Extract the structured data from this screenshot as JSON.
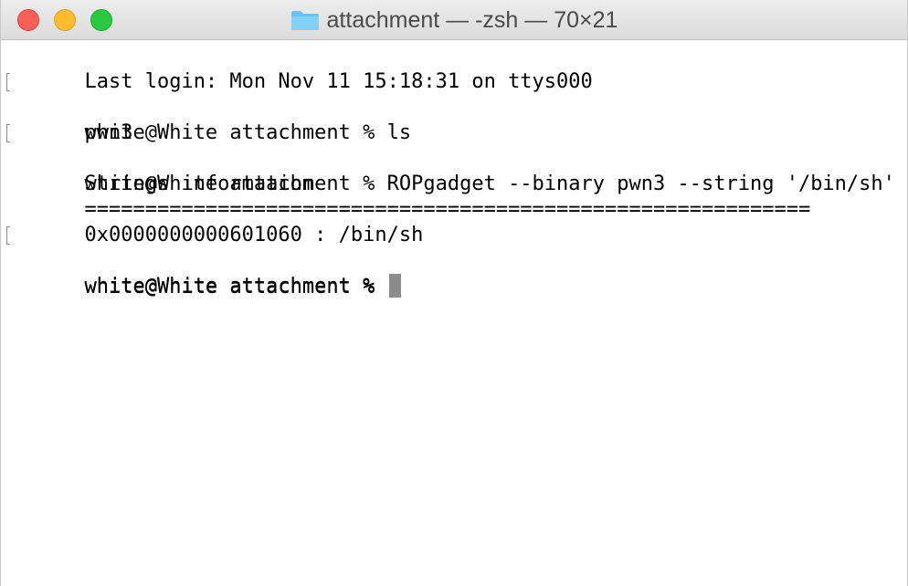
{
  "window": {
    "title": "attachment — -zsh — 70×21",
    "icon": "folder-icon",
    "buttons": {
      "close": "close-icon",
      "minimize": "minimize-icon",
      "zoom": "zoom-icon"
    }
  },
  "terminal": {
    "lines": [
      "Last login: Mon Nov 11 15:18:31 on ttys000",
      "white@White attachment % ls",
      "pwn3",
      "white@White attachment % ROPgadget --binary pwn3 --string '/bin/sh'",
      "Strings information",
      "============================================================",
      "0x0000000000601060 : /bin/sh",
      "white@White attachment %",
      "white@White attachment % "
    ]
  },
  "colors": {
    "close": "#fc5f57",
    "minimize": "#fdbc2e",
    "zoom": "#28c840",
    "folder": "#6cc2f2",
    "cursor": "#8c8c8c"
  }
}
